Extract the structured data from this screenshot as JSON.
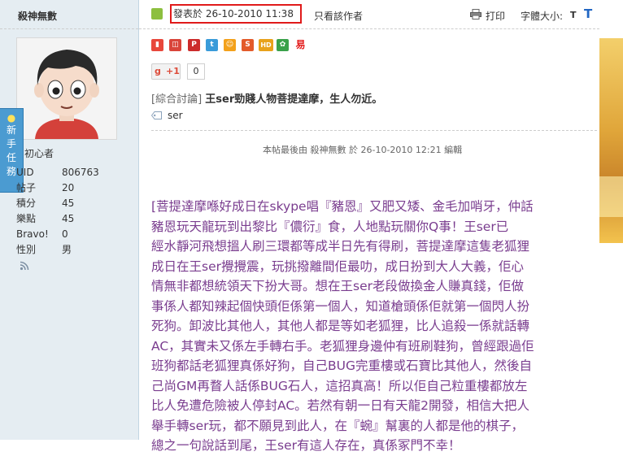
{
  "sidebar": {
    "username": "殺神無數",
    "side_tab": [
      "新",
      "手",
      "任",
      "務"
    ],
    "rank": "初心者",
    "stats": [
      {
        "k": "UID",
        "v": "806763"
      },
      {
        "k": "帖子",
        "v": "20"
      },
      {
        "k": "積分",
        "v": "45"
      },
      {
        "k": "樂點",
        "v": "45"
      },
      {
        "k": "Bravo!",
        "v": "0"
      },
      {
        "k": "性別",
        "v": "男"
      }
    ]
  },
  "post": {
    "posted_at": "發表於 26-10-2010 11:38",
    "author_only": "只看該作者",
    "print": "打印",
    "font_size_label": "字體大小:",
    "font_small": "T",
    "font_large": "T",
    "gplus": "+1",
    "gplus_count": "0",
    "title_category": "[綜合討論]",
    "title": "王ser勁賤人物菩提達摩，生人勿近。",
    "tag": "ser",
    "edit_note": "本帖最後由 殺神無數 於 26-10-2010 12:21 編輯",
    "body_lines": [
      "[菩提達摩喺好成日在skype唱『豬恩』又肥又矮、金毛加哨牙，仲話",
      "豬恩玩天龍玩到出黎比『儂衍』食，人地點玩關你Q事！王ser已",
      "經水靜河飛想搵人刷三環都等成半日先有得刷，菩提達摩這隻老狐狸",
      "成日在王ser攪攪震，玩挑撥離間佢最叻，成日扮到大人大義，佢心",
      "情無非都想統領天下扮大哥。想在王ser老段做換金人賺真錢，佢做",
      "事係人都知辣起個快頭佢係第一個人，知道槍頭係佢就第一個閃人扮",
      "死狗。卸波比其他人，其他人都是等如老狐狸，比人追殺一係就話轉",
      "AC，其實未又係左手轉右手。老狐狸身邊仲有班刷鞋狗，曾經跟過佢",
      "班狗都話老狐狸真係好狗，自己BUG完重樓或石寶比其他人，然後自",
      "己尚GM再瞀人話係BUG石人，這招真高！所以佢自己粒重樓都放左",
      "比人免遭危險被人停封AC。若然有朝一日有天龍2開發，相信大把人",
      "舉手轉ser玩，都不願見到此人，在『蜿』幫裏的人都是他的棋子，",
      "總之一句說話到尾，王ser有這人存在，真係冢門不幸！"
    ]
  },
  "icons": {
    "share": [
      {
        "name": "share-icon-1",
        "color": "#e8473b",
        "glyph": "▮"
      },
      {
        "name": "share-icon-2",
        "color": "#d9443a",
        "glyph": "◫"
      },
      {
        "name": "share-icon-3",
        "color": "#cc2b2b",
        "glyph": "P"
      },
      {
        "name": "share-icon-4",
        "color": "#3a9bd9",
        "glyph": "t"
      },
      {
        "name": "share-icon-5",
        "color": "#f3a11b",
        "glyph": "☺"
      },
      {
        "name": "share-icon-6",
        "color": "#e35a2a",
        "glyph": "S"
      },
      {
        "name": "share-icon-7",
        "color": "#e8a21b",
        "glyph": "HD"
      },
      {
        "name": "share-icon-8",
        "color": "#3aa14a",
        "glyph": "✿"
      },
      {
        "name": "share-icon-9",
        "color": "#e31b1b",
        "glyph": "易"
      }
    ]
  },
  "colors": {
    "body_text": "#7a3d8f",
    "highlight_box": "#e01a1a",
    "sidebar_bg": "#e5edf2",
    "link_blue": "#2166c3"
  }
}
